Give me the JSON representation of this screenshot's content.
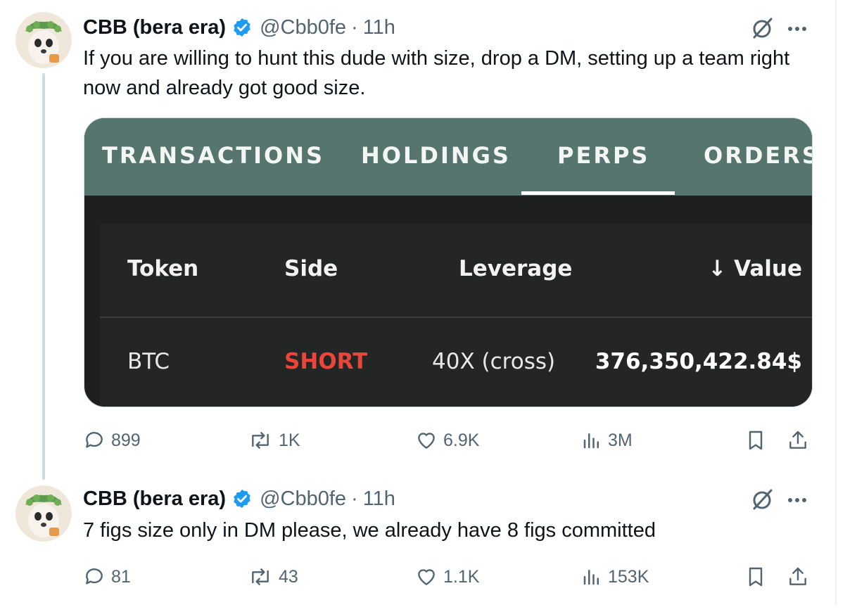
{
  "tweets": [
    {
      "author": "CBB (bera era)",
      "handle": "@Cbb0fe",
      "separator": "·",
      "time": "11h",
      "text": "If you are willing to hunt this dude with size, drop a DM, setting up a team right now and already got good size.",
      "media": {
        "tabs": [
          "TRANSACTIONS",
          "HOLDINGS",
          "PERPS",
          "ORDERS"
        ],
        "active_tab": "PERPS",
        "columns": [
          "Token",
          "Side",
          "Leverage",
          "Value"
        ],
        "sort_indicator": "↓",
        "row": {
          "token": "BTC",
          "side": "SHORT",
          "leverage": "40X (cross)",
          "value": "376,350,422.84$"
        }
      },
      "stats": {
        "replies": "899",
        "reposts": "1K",
        "likes": "6.9K",
        "views": "3M"
      }
    },
    {
      "author": "CBB (bera era)",
      "handle": "@Cbb0fe",
      "separator": "·",
      "time": "11h",
      "text": "7 figs size only in DM please, we already have 8 figs committed",
      "stats": {
        "replies": "81",
        "reposts": "43",
        "likes": "1.1K",
        "views": "153K"
      }
    }
  ],
  "colors": {
    "text": "#0f1419",
    "secondary": "#536471",
    "verified": "#1d9bf0",
    "tab_bar": "#56756e",
    "short": "#e9453b"
  }
}
